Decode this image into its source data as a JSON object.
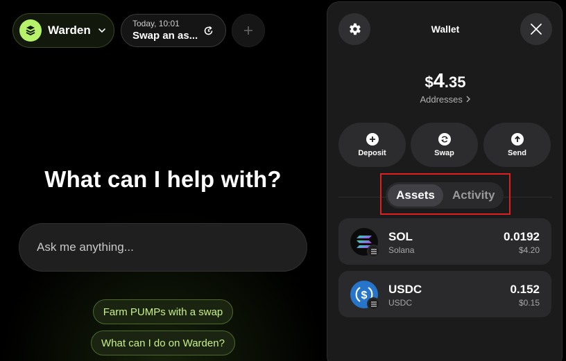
{
  "brand": {
    "name": "Warden",
    "accent": "#b6f36a"
  },
  "current_chat": {
    "time": "Today, 10:01",
    "title": "Swap an as..."
  },
  "main": {
    "headline": "What can I help with?",
    "input_placeholder": "Ask me anything...",
    "suggestions": [
      "Farm PUMPs with a swap",
      "What can I do on Warden?"
    ]
  },
  "wallet": {
    "title": "Wallet",
    "balance": {
      "currency": "$",
      "integer": "4",
      "decimal": ".35"
    },
    "addresses_label": "Addresses",
    "actions": [
      {
        "label": "Deposit",
        "icon": "plus-icon"
      },
      {
        "label": "Swap",
        "icon": "swap-icon"
      },
      {
        "label": "Send",
        "icon": "arrow-up-icon"
      }
    ],
    "tabs": {
      "active": "Assets",
      "items": [
        "Assets",
        "Activity"
      ]
    },
    "assets": [
      {
        "symbol": "SOL",
        "name": "Solana",
        "amount": "0.0192",
        "value": "$4.20",
        "logo": "solana-logo"
      },
      {
        "symbol": "USDC",
        "name": "USDC",
        "amount": "0.152",
        "value": "$0.15",
        "logo": "usdc-logo"
      }
    ]
  }
}
